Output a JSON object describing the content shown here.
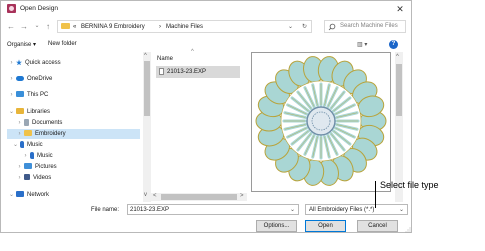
{
  "window": {
    "title": "Open Design",
    "close_glyph": "✕"
  },
  "nav": {
    "back_glyph": "←",
    "forward_glyph": "→",
    "recent_glyph": "⌄",
    "up_glyph": "↑",
    "breadcrumb_chevron": "«",
    "breadcrumb": [
      "BERNINA 9 Embroidery",
      "Machine Files"
    ],
    "separator": "›",
    "dropdown_glyph": "⌄",
    "refresh_glyph": "↻",
    "search_placeholder": "Search Machine Files"
  },
  "toolbar": {
    "organize_label": "Organise ▾",
    "new_folder_label": "New folder",
    "view_glyph": "▥ ▾",
    "help_glyph": "?"
  },
  "sidebar": {
    "items": [
      {
        "label": "Quick access",
        "chevron": "›",
        "icon": "star-icon",
        "color": "#1e78d2"
      },
      {
        "label": "OneDrive",
        "chevron": "›",
        "icon": "cloud-icon",
        "color": "#1e78d2"
      },
      {
        "label": "This PC",
        "chevron": "›",
        "icon": "monitor-icon",
        "color": "#3a8fd9"
      },
      {
        "label": "Libraries",
        "chevron": "⌄",
        "icon": "libraries-icon",
        "color": "#e8b53a"
      },
      {
        "label": "Documents",
        "chevron": "›",
        "icon": "document-icon",
        "color": "#9aa7b4"
      },
      {
        "label": "Embroidery",
        "chevron": "›",
        "icon": "folder-icon",
        "color": "#f0c24a"
      },
      {
        "label": "Music",
        "chevron": "⌄",
        "icon": "music-icon",
        "color": "#2a6fc9"
      },
      {
        "label": "Music",
        "chevron": "›",
        "icon": "music-icon",
        "color": "#2a6fc9"
      },
      {
        "label": "Pictures",
        "chevron": "›",
        "icon": "pictures-icon",
        "color": "#3f8fd8"
      },
      {
        "label": "Videos",
        "chevron": "›",
        "icon": "videos-icon",
        "color": "#3f5a8a"
      },
      {
        "label": "Network",
        "chevron": "⌄",
        "icon": "network-icon",
        "color": "#2a6fc9"
      }
    ],
    "selected_index": 5
  },
  "files": {
    "column_name": "Name",
    "sort_glyph": "^",
    "items": [
      {
        "name": "21013-23.EXP"
      }
    ]
  },
  "bottom": {
    "filename_label": "File name:",
    "filename_value": "21013-23.EXP",
    "filetype_value": "All Embroidery Files (*.*)",
    "options_label": "Options...",
    "open_label": "Open",
    "cancel_label": "Cancel",
    "dropdown_glyph": "⌄"
  },
  "annotation": {
    "text": "Select file type"
  },
  "colors": {
    "accent": "#0078d7",
    "selection": "#cce4f7",
    "preview_fill": "#a9d6d4",
    "preview_outline": "#b8a33a",
    "preview_center": "#6f8fa8"
  }
}
